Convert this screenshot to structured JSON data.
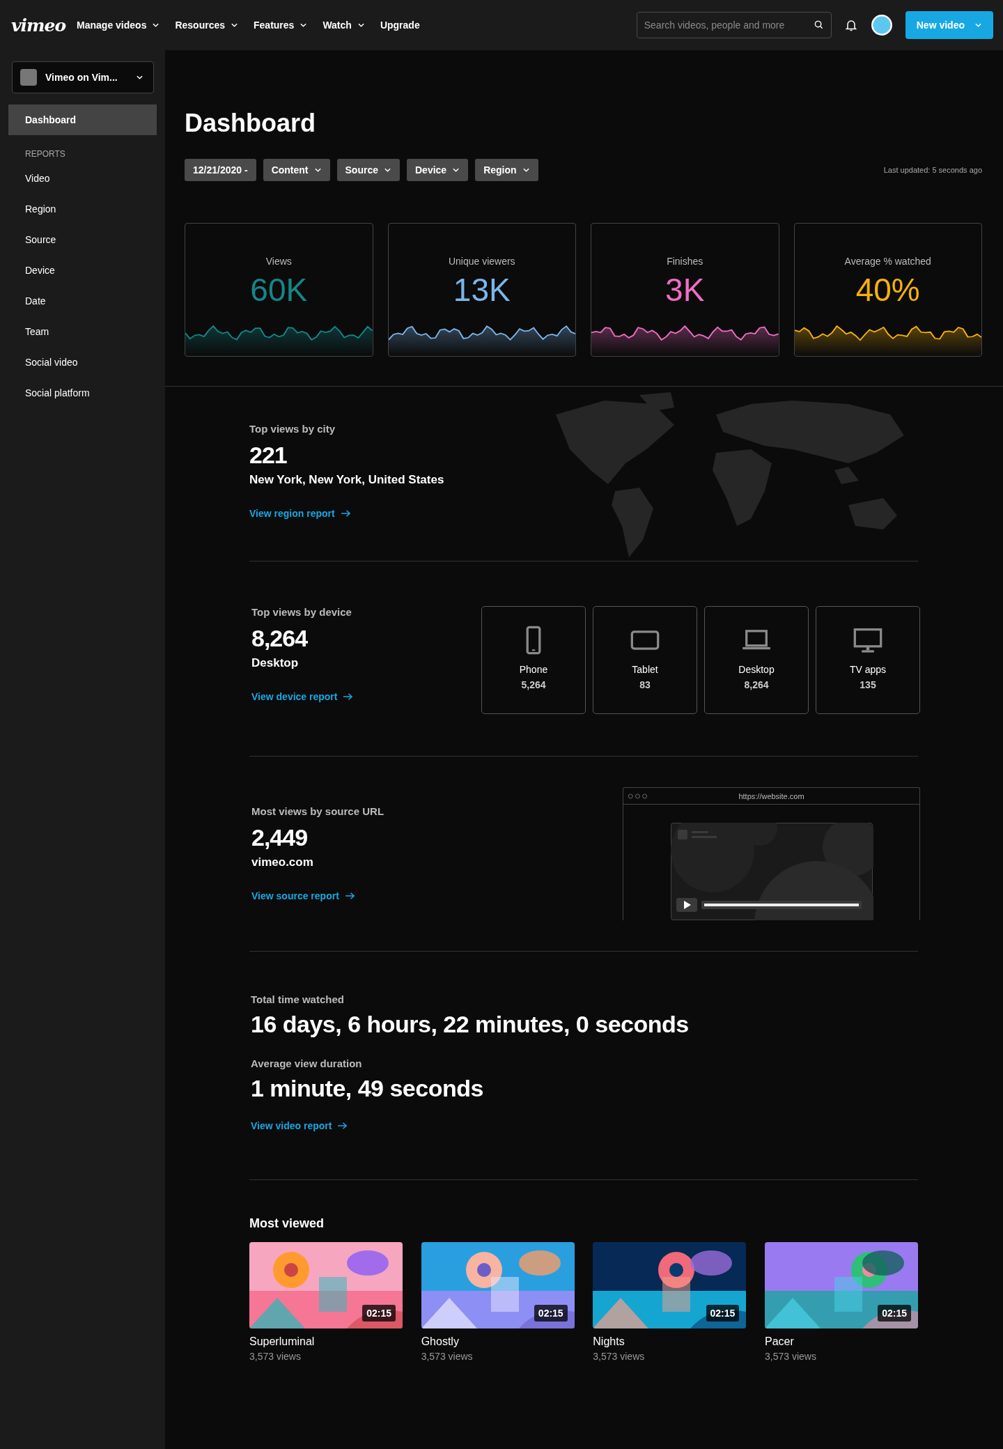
{
  "nav": {
    "logo": "vimeo",
    "menu": [
      {
        "label": "Manage videos",
        "dropdown": true
      },
      {
        "label": "Resources",
        "dropdown": true
      },
      {
        "label": "Features",
        "dropdown": true
      },
      {
        "label": "Watch",
        "dropdown": true
      },
      {
        "label": "Upgrade",
        "dropdown": false
      }
    ],
    "search": {
      "placeholder": "Search videos, people and more"
    },
    "new_button": "New video"
  },
  "sidebar": {
    "account": "Vimeo on Vim...",
    "items": [
      {
        "label": "Dashboard",
        "selected": true
      }
    ],
    "section": "REPORTS",
    "reports": [
      {
        "label": "Video",
        "selected": false
      },
      {
        "label": "Region",
        "selected": false
      },
      {
        "label": "Source",
        "selected": false
      },
      {
        "label": "Device",
        "selected": false
      },
      {
        "label": "Date",
        "selected": false
      },
      {
        "label": "Team",
        "selected": false
      },
      {
        "label": "Social video",
        "selected": false
      },
      {
        "label": "Social platform",
        "selected": false
      }
    ]
  },
  "page": {
    "title": "Dashboard",
    "filters": [
      {
        "kind": "date",
        "label": "12/21/2020 -"
      },
      {
        "kind": "dropdown",
        "label": "Content"
      },
      {
        "kind": "dropdown",
        "label": "Source"
      },
      {
        "kind": "dropdown",
        "label": "Device"
      },
      {
        "kind": "dropdown",
        "label": "Region"
      }
    ],
    "last_updated": "Last updated: 5 seconds ago"
  },
  "stats": [
    {
      "label": "Views",
      "value": "60K",
      "color": "#13878a"
    },
    {
      "label": "Unique viewers",
      "value": "13K",
      "color": "#7ab6ea"
    },
    {
      "label": "Finishes",
      "value": "3K",
      "color": "#f26cc6"
    },
    {
      "label": "Average % watched",
      "value": "40%",
      "color": "#f6b10a"
    }
  ],
  "city": {
    "label": "Top views by city",
    "value": "221",
    "name": "New York, New York, United States",
    "link": "View region report"
  },
  "device": {
    "label": "Top views by device",
    "value": "8,264",
    "name": "Desktop",
    "link": "View device report",
    "devices": [
      {
        "kind": "phone",
        "label": "Phone",
        "value": "5,264"
      },
      {
        "kind": "tablet",
        "label": "Tablet",
        "value": "83"
      },
      {
        "kind": "laptop",
        "label": "Desktop",
        "value": "8,264"
      },
      {
        "kind": "tv",
        "label": "TV apps",
        "value": "135"
      }
    ]
  },
  "source": {
    "label": "Most views by source URL",
    "value": "2,449",
    "name": "vimeo.com",
    "link": "View source report",
    "browser_url": "https://website.com"
  },
  "time": {
    "items": [
      {
        "label": "Total time watched",
        "value": "16 days, 6 hours, 22 minutes, 0 seconds"
      },
      {
        "label": "Average view duration",
        "value": "1 minute, 49 seconds"
      }
    ],
    "link": "View video report"
  },
  "most_viewed": {
    "title": "Most viewed",
    "videos": [
      {
        "title": "Superluminal",
        "views": "3,573 views",
        "duration": "02:15"
      },
      {
        "title": "Ghostly",
        "views": "3,573 views",
        "duration": "02:15"
      },
      {
        "title": "Nights",
        "views": "3,573 views",
        "duration": "02:15"
      },
      {
        "title": "Pacer",
        "views": "3,573 views",
        "duration": "02:15"
      }
    ]
  }
}
